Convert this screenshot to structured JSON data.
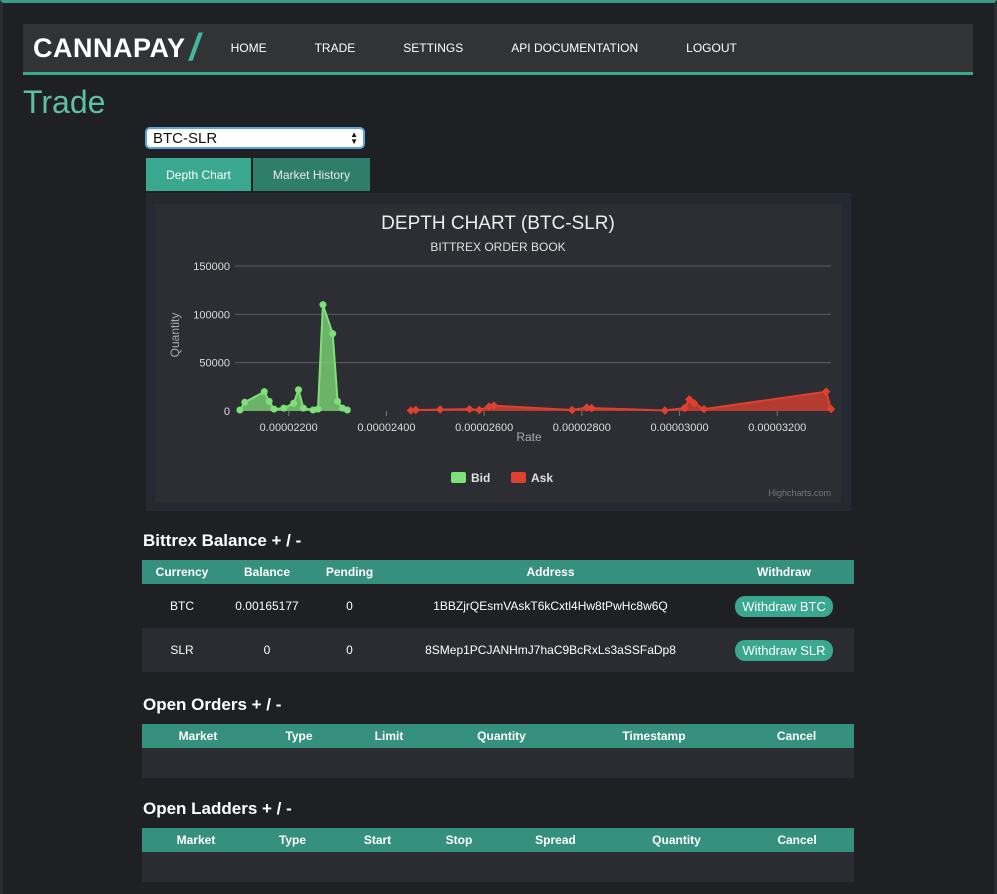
{
  "brand": {
    "name": "CANNAPAY",
    "slash": "/"
  },
  "nav": {
    "items": [
      "HOME",
      "TRADE",
      "SETTINGS",
      "API DOCUMENTATION",
      "LOGOUT"
    ]
  },
  "page": {
    "title": "Trade"
  },
  "market_select": {
    "value": "BTC-SLR"
  },
  "tabs": [
    "Depth Chart",
    "Market History"
  ],
  "colors": {
    "accent": "#3aa88e",
    "bid": "#7fe07a",
    "ask": "#e0402f",
    "title": "#5fbfa3"
  },
  "chart_data": {
    "type": "area",
    "title": "DEPTH CHART (BTC-SLR)",
    "subtitle": "BITTREX ORDER BOOK",
    "xlabel": "Rate",
    "ylabel": "Quantity",
    "xlim": [
      2.09e-05,
      3.31e-05
    ],
    "ylim": [
      0,
      150000
    ],
    "yticks": [
      0,
      50000,
      100000,
      150000
    ],
    "xticks": [
      2.2e-05,
      2.4e-05,
      2.6e-05,
      2.8e-05,
      3e-05,
      3.2e-05
    ],
    "xtick_labels": [
      "0.00002200",
      "0.00002400",
      "0.00002600",
      "0.00002800",
      "0.00003000",
      "0.00003200"
    ],
    "ytick_labels": [
      "0",
      "50000",
      "100000",
      "150000"
    ],
    "legend_position": "bottom-center",
    "credit": "Highcharts.com",
    "series": [
      {
        "name": "Bid",
        "color": "#7fe07a",
        "points": [
          [
            2.1e-05,
            1000
          ],
          [
            2.11e-05,
            9000
          ],
          [
            2.15e-05,
            20000
          ],
          [
            2.16e-05,
            10000
          ],
          [
            2.17e-05,
            2000
          ],
          [
            2.19e-05,
            3000
          ],
          [
            2.21e-05,
            8000
          ],
          [
            2.22e-05,
            22000
          ],
          [
            2.23e-05,
            3000
          ],
          [
            2.25e-05,
            1000
          ],
          [
            2.26e-05,
            2000
          ],
          [
            2.27e-05,
            110000
          ],
          [
            2.29e-05,
            80000
          ],
          [
            2.3e-05,
            10000
          ],
          [
            2.31e-05,
            3000
          ],
          [
            2.32e-05,
            1000
          ]
        ]
      },
      {
        "name": "Ask",
        "color": "#e0402f",
        "points": [
          [
            2.45e-05,
            500
          ],
          [
            2.46e-05,
            1000
          ],
          [
            2.51e-05,
            1500
          ],
          [
            2.57e-05,
            2000
          ],
          [
            2.59e-05,
            1000
          ],
          [
            2.61e-05,
            4500
          ],
          [
            2.62e-05,
            5500
          ],
          [
            2.78e-05,
            1000
          ],
          [
            2.81e-05,
            3500
          ],
          [
            2.82e-05,
            3000
          ],
          [
            2.97e-05,
            500
          ],
          [
            3.01e-05,
            3000
          ],
          [
            3.02e-05,
            12000
          ],
          [
            3.03e-05,
            8000
          ],
          [
            3.05e-05,
            2000
          ],
          [
            3.3e-05,
            20000
          ],
          [
            3.31e-05,
            2000
          ]
        ]
      }
    ]
  },
  "balance": {
    "title": "Bittrex Balance + / -",
    "headers": [
      "Currency",
      "Balance",
      "Pending",
      "Address",
      "Withdraw"
    ],
    "rows": [
      {
        "currency": "BTC",
        "balance": "0.00165177",
        "pending": "0",
        "address": "1BBZjrQEsmVAskT6kCxtl4Hw8tPwHc8w6Q",
        "button": "Withdraw BTC"
      },
      {
        "currency": "SLR",
        "balance": "0",
        "pending": "0",
        "address": "8SMep1PCJANHmJ7haC9BcRxLs3aSSFaDp8",
        "button": "Withdraw SLR"
      }
    ]
  },
  "orders": {
    "title": "Open Orders + / -",
    "headers": [
      "Market",
      "Type",
      "Limit",
      "Quantity",
      "Timestamp",
      "Cancel"
    ]
  },
  "ladders": {
    "title": "Open Ladders + / -",
    "headers": [
      "Market",
      "Type",
      "Start",
      "Stop",
      "Spread",
      "Quantity",
      "Cancel"
    ]
  }
}
